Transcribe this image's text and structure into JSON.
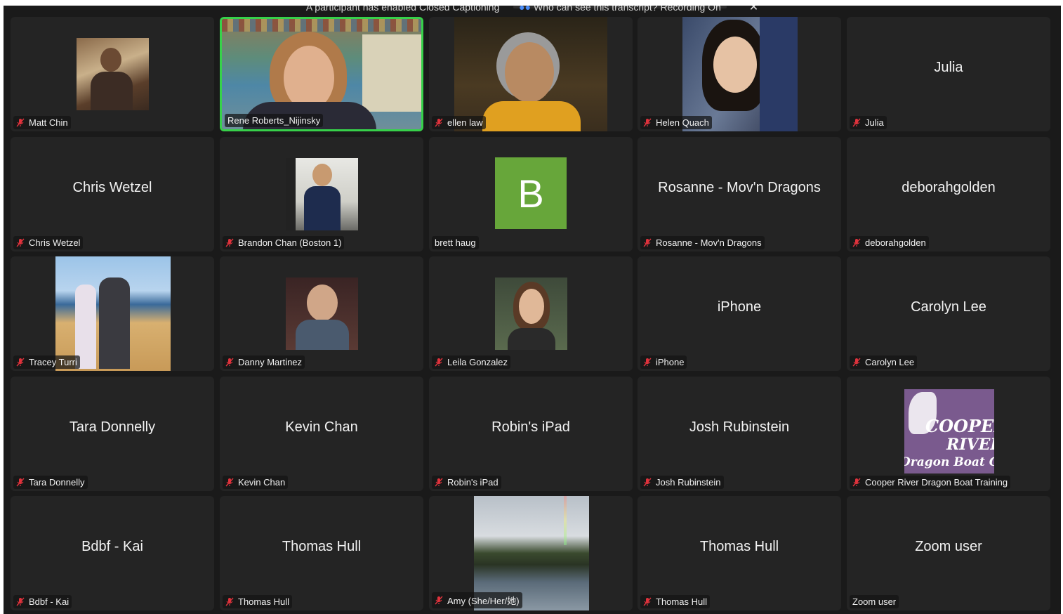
{
  "banner": {
    "caption_notice": "A participant has enabled Closed Captioning",
    "transcript_link": "Who can see this transcript? Recording On",
    "close_icon": "close-icon"
  },
  "colors": {
    "tile_bg": "#242424",
    "window_bg": "#1a1a1a",
    "active_speaker_border": "#37d14a",
    "mute_red": "#e0323c",
    "avatar_b_bg": "#67a63a"
  },
  "tiles": [
    {
      "label": "Matt Chin",
      "center": "",
      "muted": true,
      "media": "photo"
    },
    {
      "label": "Rene Roberts_Nijinsky",
      "center": "",
      "muted": false,
      "media": "video",
      "active": true
    },
    {
      "label": "ellen law",
      "center": "",
      "muted": true,
      "media": "video"
    },
    {
      "label": "Helen Quach",
      "center": "",
      "muted": true,
      "media": "photo"
    },
    {
      "label": "Julia",
      "center": "Julia",
      "muted": true,
      "media": "none"
    },
    {
      "label": "Chris Wetzel",
      "center": "Chris Wetzel",
      "muted": true,
      "media": "none"
    },
    {
      "label": "Brandon Chan (Boston 1)",
      "center": "",
      "muted": true,
      "media": "photo"
    },
    {
      "label": "brett haug",
      "center": "",
      "muted": false,
      "media": "avatar",
      "avatar_letter": "B"
    },
    {
      "label": "Rosanne - Mov'n Dragons",
      "center": "Rosanne - Mov'n Dragons",
      "muted": true,
      "media": "none"
    },
    {
      "label": "deborahgolden",
      "center": "deborahgolden",
      "muted": true,
      "media": "none"
    },
    {
      "label": "Tracey Turri",
      "center": "",
      "muted": true,
      "media": "photo"
    },
    {
      "label": "Danny Martinez",
      "center": "",
      "muted": true,
      "media": "photo"
    },
    {
      "label": "Leila Gonzalez",
      "center": "",
      "muted": true,
      "media": "photo"
    },
    {
      "label": "iPhone",
      "center": "iPhone",
      "muted": true,
      "media": "none"
    },
    {
      "label": "Carolyn Lee",
      "center": "Carolyn Lee",
      "muted": true,
      "media": "none"
    },
    {
      "label": "Tara Donnelly",
      "center": "Tara Donnelly",
      "muted": true,
      "media": "none"
    },
    {
      "label": "Kevin Chan",
      "center": "Kevin Chan",
      "muted": true,
      "media": "none"
    },
    {
      "label": "Robin's iPad",
      "center": "Robin's iPad",
      "muted": true,
      "media": "none"
    },
    {
      "label": "Josh Rubinstein",
      "center": "Josh Rubinstein",
      "muted": true,
      "media": "none"
    },
    {
      "label": "Cooper River Dragon Boat Training",
      "center": "",
      "muted": true,
      "media": "logo",
      "logo_text": [
        "COOPER",
        "RIVER",
        "Dragon Boat Club"
      ]
    },
    {
      "label": "Bdbf - Kai",
      "center": "Bdbf - Kai",
      "muted": true,
      "media": "none"
    },
    {
      "label": "Thomas Hull",
      "center": "Thomas Hull",
      "muted": true,
      "media": "none"
    },
    {
      "label": "Amy (She/Her/她)",
      "center": "",
      "muted": true,
      "media": "photo"
    },
    {
      "label": "Thomas Hull",
      "center": "Thomas Hull",
      "muted": true,
      "media": "none"
    },
    {
      "label": "Zoom user",
      "center": "Zoom user",
      "muted": false,
      "media": "none"
    }
  ]
}
